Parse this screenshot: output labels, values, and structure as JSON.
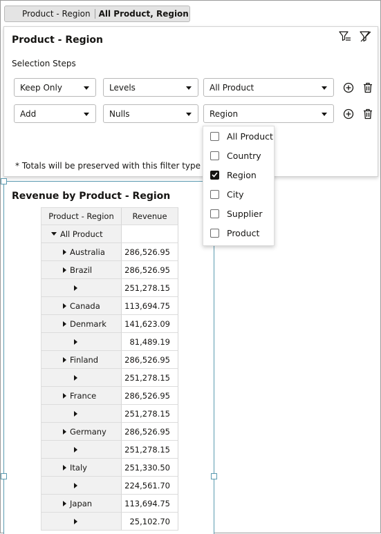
{
  "filter_bar": {
    "name": "Product - Region",
    "value": "All Product, Region"
  },
  "popup": {
    "title": "Product - Region",
    "steps_label": "Selection Steps",
    "rows": [
      {
        "action": "Keep Only",
        "method": "Levels",
        "value": "All Product"
      },
      {
        "action": "Add",
        "method": "Nulls",
        "value": "Region"
      }
    ],
    "note": "* Totals will be preserved with this filter type"
  },
  "dropdown": {
    "options": [
      {
        "label": "All Product",
        "checked": false
      },
      {
        "label": "Country",
        "checked": false
      },
      {
        "label": "Region",
        "checked": true
      },
      {
        "label": "City",
        "checked": false
      },
      {
        "label": "Supplier",
        "checked": false
      },
      {
        "label": "Product",
        "checked": false
      }
    ]
  },
  "report": {
    "title": "Revenue by Product - Region",
    "columns": [
      "Product - Region",
      "Revenue"
    ],
    "rows": [
      {
        "label": "All Product",
        "revenue": "",
        "level": 0,
        "expanded": true
      },
      {
        "label": "Australia",
        "revenue": "286,526.95",
        "level": 1
      },
      {
        "label": "Brazil",
        "revenue": "286,526.95",
        "level": 1
      },
      {
        "label": "",
        "revenue": "251,278.15",
        "level": 2
      },
      {
        "label": "Canada",
        "revenue": "113,694.75",
        "level": 1
      },
      {
        "label": "Denmark",
        "revenue": "141,623.09",
        "level": 1
      },
      {
        "label": "",
        "revenue": "81,489.19",
        "level": 2
      },
      {
        "label": "Finland",
        "revenue": "286,526.95",
        "level": 1
      },
      {
        "label": "",
        "revenue": "251,278.15",
        "level": 2
      },
      {
        "label": "France",
        "revenue": "286,526.95",
        "level": 1
      },
      {
        "label": "",
        "revenue": "251,278.15",
        "level": 2
      },
      {
        "label": "Germany",
        "revenue": "286,526.95",
        "level": 1
      },
      {
        "label": "",
        "revenue": "251,278.15",
        "level": 2
      },
      {
        "label": "Italy",
        "revenue": "251,330.50",
        "level": 1
      },
      {
        "label": "",
        "revenue": "224,561.70",
        "level": 2
      },
      {
        "label": "Japan",
        "revenue": "113,694.75",
        "level": 1
      },
      {
        "label": "",
        "revenue": "25,102.70",
        "level": 2
      }
    ]
  }
}
